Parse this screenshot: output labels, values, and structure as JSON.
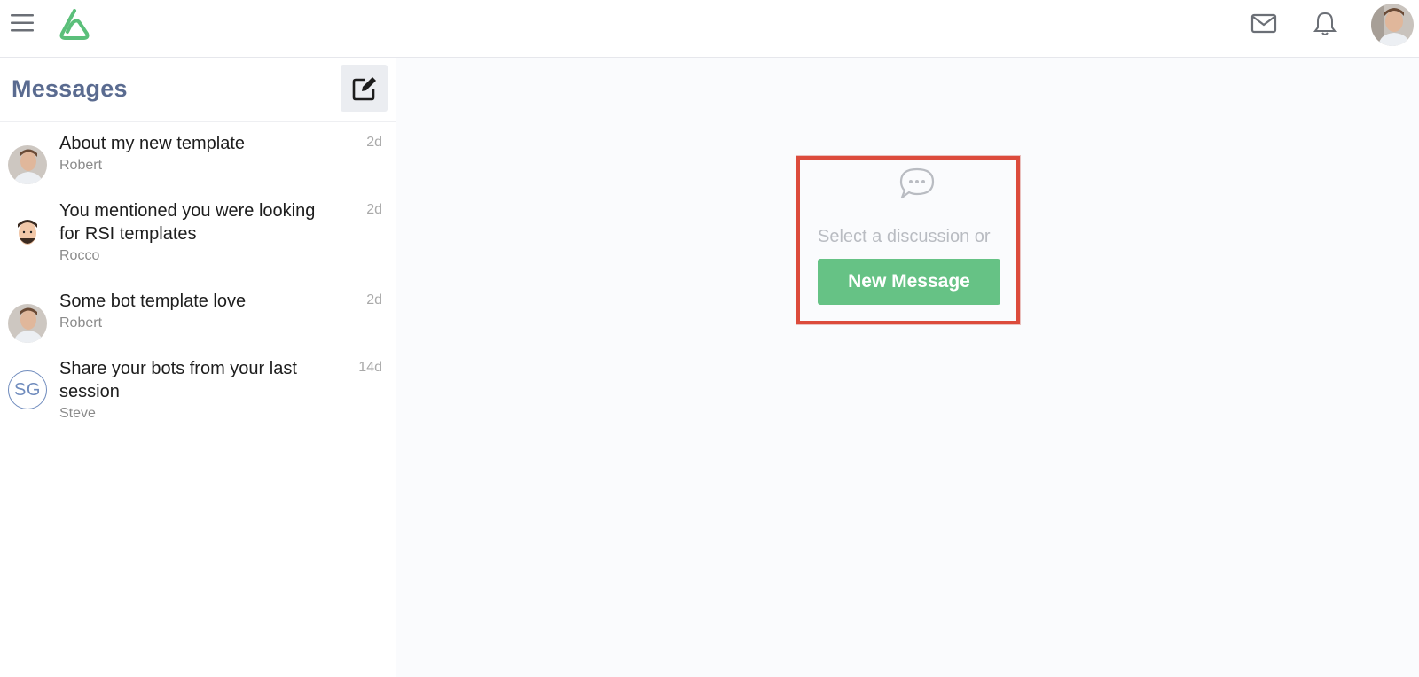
{
  "app": {
    "brand_color": "#5bbf7a",
    "icons": [
      "menu-icon",
      "logo-icon",
      "mail-icon",
      "bell-icon",
      "compose-icon",
      "chat-bubble-icon"
    ]
  },
  "sidebar": {
    "title": "Messages",
    "threads": [
      {
        "subject": "About my new template",
        "author": "Robert",
        "time": "2d",
        "avatar": "photo"
      },
      {
        "subject": "You mentioned you were looking for RSI templates",
        "author": "Rocco",
        "time": "2d",
        "avatar": "cartoon"
      },
      {
        "subject": "Some bot template love",
        "author": "Robert",
        "time": "2d",
        "avatar": "photo"
      },
      {
        "subject": "Share your bots from your last session",
        "author": "Steve",
        "time": "14d",
        "avatar": "initials",
        "initials": "SG"
      }
    ]
  },
  "main": {
    "empty_text": "Select a discussion or",
    "new_message_label": "New Message",
    "accent_color": "#66c285",
    "highlight_color": "#dc4b3c"
  }
}
